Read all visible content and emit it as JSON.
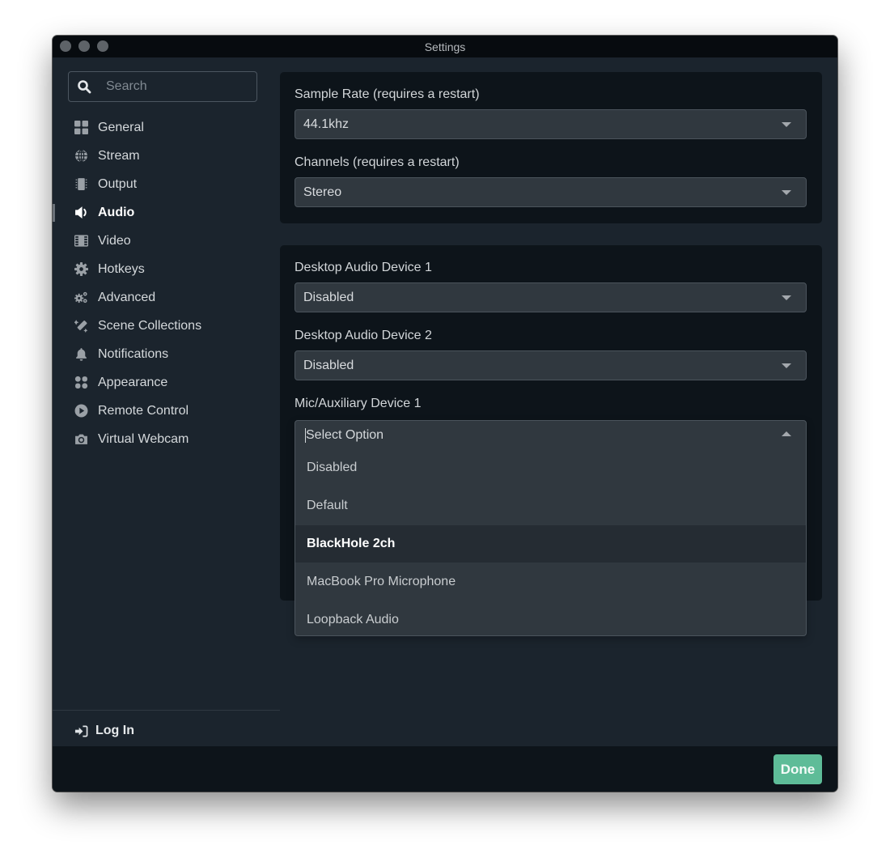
{
  "window": {
    "title": "Settings"
  },
  "sidebar": {
    "search_placeholder": "Search",
    "search_value": "",
    "items": [
      {
        "label": "General",
        "icon": "grid-icon"
      },
      {
        "label": "Stream",
        "icon": "globe-icon"
      },
      {
        "label": "Output",
        "icon": "chip-icon"
      },
      {
        "label": "Audio",
        "icon": "speaker-icon",
        "active": true
      },
      {
        "label": "Video",
        "icon": "film-icon"
      },
      {
        "label": "Hotkeys",
        "icon": "gear-icon"
      },
      {
        "label": "Advanced",
        "icon": "gears-icon"
      },
      {
        "label": "Scene Collections",
        "icon": "magic-wand-icon"
      },
      {
        "label": "Notifications",
        "icon": "bell-icon"
      },
      {
        "label": "Appearance",
        "icon": "shapes-icon"
      },
      {
        "label": "Remote Control",
        "icon": "play-circle-icon"
      },
      {
        "label": "Virtual Webcam",
        "icon": "camera-icon"
      }
    ],
    "login_label": "Log In"
  },
  "audio": {
    "sample_rate": {
      "label": "Sample Rate (requires a restart)",
      "value": "44.1khz"
    },
    "channels": {
      "label": "Channels (requires a restart)",
      "value": "Stereo"
    },
    "desktop_audio_1": {
      "label": "Desktop Audio Device 1",
      "value": "Disabled"
    },
    "desktop_audio_2": {
      "label": "Desktop Audio Device 2",
      "value": "Disabled"
    },
    "mic_aux_1": {
      "label": "Mic/Auxiliary Device 1",
      "placeholder": "Select Option",
      "options": [
        "Disabled",
        "Default",
        "BlackHole 2ch",
        "MacBook Pro Microphone",
        "Loopback Audio"
      ],
      "highlighted": "BlackHole 2ch"
    }
  },
  "footer": {
    "done_label": "Done"
  },
  "colors": {
    "accent": "#5ebc98",
    "window_bg": "#1b242d",
    "panel_bg": "#0d141a",
    "select_bg": "#30383f"
  }
}
